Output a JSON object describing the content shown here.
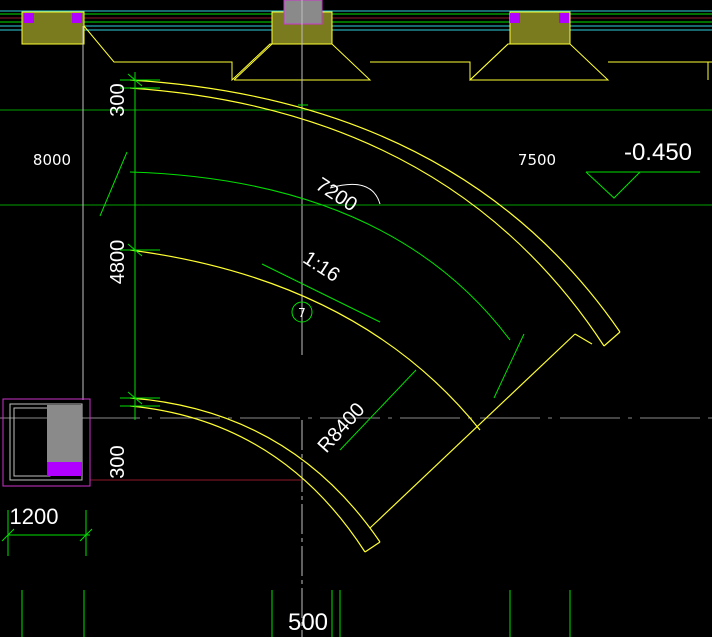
{
  "drawing": {
    "dimensions": {
      "top_offset": "300",
      "middle_span": "4800",
      "bottom_offset": "300",
      "left_width": "1200",
      "bottom_width": "500"
    },
    "grid_spacings": {
      "left_bay": "8000",
      "right_bay": "7500"
    },
    "arc_length": "7200",
    "slope": "1:16",
    "radius": "R8400",
    "elevation": "-0.450",
    "axis_bubble": "7"
  },
  "colors": {
    "background": "#000000",
    "ramp_line": "#ffff33",
    "dimension": "#00e000",
    "axis": "#bfbfbf",
    "column_fill": "#7a7a1e",
    "marker": "#b000ff",
    "boundary": "#cc33cc",
    "dark_red": "#8b1a2a",
    "cyan": "#30d0e0",
    "text": "#ffffff"
  },
  "icons": {
    "axis_bubble": "axis-bubble-icon",
    "elevation_marker": "elevation-triangle-icon",
    "column_markers": "column-marker-icon"
  }
}
